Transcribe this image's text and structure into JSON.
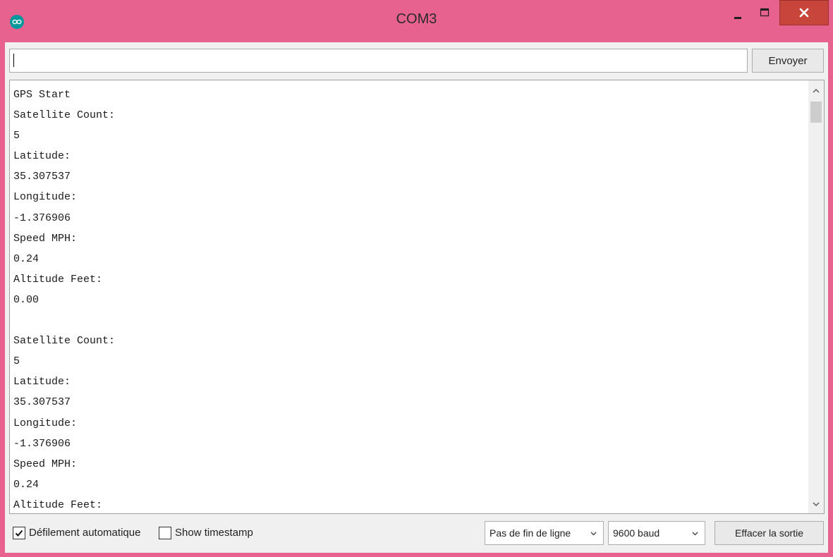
{
  "window": {
    "title": "COM3"
  },
  "colors": {
    "titlebar": "#e8628f",
    "close_button": "#c8453c",
    "arduino_teal": "#00979c"
  },
  "icons": {
    "app": "arduino-logo-icon",
    "minimize": "minimize-icon",
    "maximize": "maximize-icon",
    "close": "close-icon"
  },
  "send": {
    "input_value": "",
    "button_label": "Envoyer"
  },
  "output": {
    "lines": [
      "GPS Start",
      "Satellite Count:",
      "5",
      "Latitude:",
      "35.307537",
      "Longitude:",
      "-1.376906",
      "Speed MPH:",
      "0.24",
      "Altitude Feet:",
      "0.00",
      "",
      "Satellite Count:",
      "5",
      "Latitude:",
      "35.307537",
      "Longitude:",
      "-1.376906",
      "Speed MPH:",
      "0.24",
      "Altitude Feet:"
    ]
  },
  "options": {
    "autoscroll": {
      "label": "Défilement automatique",
      "checked": true
    },
    "timestamp": {
      "label": "Show timestamp",
      "checked": false
    },
    "line_ending": "Pas de fin de ligne",
    "baud_rate": "9600 baud",
    "clear_label": "Effacer la sortie"
  }
}
